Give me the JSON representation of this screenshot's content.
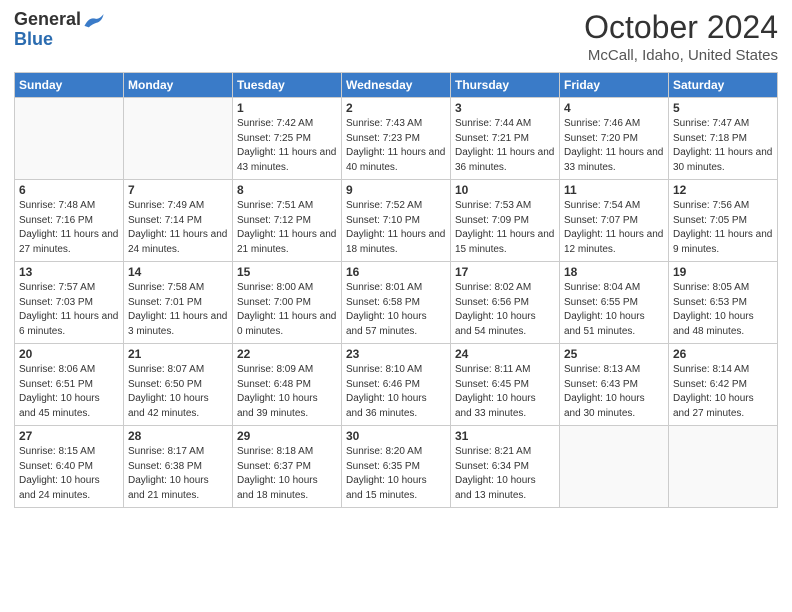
{
  "header": {
    "logo_general": "General",
    "logo_blue": "Blue",
    "month": "October 2024",
    "location": "McCall, Idaho, United States"
  },
  "days_of_week": [
    "Sunday",
    "Monday",
    "Tuesday",
    "Wednesday",
    "Thursday",
    "Friday",
    "Saturday"
  ],
  "weeks": [
    [
      {
        "day": "",
        "sunrise": "",
        "sunset": "",
        "daylight": ""
      },
      {
        "day": "",
        "sunrise": "",
        "sunset": "",
        "daylight": ""
      },
      {
        "day": "1",
        "sunrise": "Sunrise: 7:42 AM",
        "sunset": "Sunset: 7:25 PM",
        "daylight": "Daylight: 11 hours and 43 minutes."
      },
      {
        "day": "2",
        "sunrise": "Sunrise: 7:43 AM",
        "sunset": "Sunset: 7:23 PM",
        "daylight": "Daylight: 11 hours and 40 minutes."
      },
      {
        "day": "3",
        "sunrise": "Sunrise: 7:44 AM",
        "sunset": "Sunset: 7:21 PM",
        "daylight": "Daylight: 11 hours and 36 minutes."
      },
      {
        "day": "4",
        "sunrise": "Sunrise: 7:46 AM",
        "sunset": "Sunset: 7:20 PM",
        "daylight": "Daylight: 11 hours and 33 minutes."
      },
      {
        "day": "5",
        "sunrise": "Sunrise: 7:47 AM",
        "sunset": "Sunset: 7:18 PM",
        "daylight": "Daylight: 11 hours and 30 minutes."
      }
    ],
    [
      {
        "day": "6",
        "sunrise": "Sunrise: 7:48 AM",
        "sunset": "Sunset: 7:16 PM",
        "daylight": "Daylight: 11 hours and 27 minutes."
      },
      {
        "day": "7",
        "sunrise": "Sunrise: 7:49 AM",
        "sunset": "Sunset: 7:14 PM",
        "daylight": "Daylight: 11 hours and 24 minutes."
      },
      {
        "day": "8",
        "sunrise": "Sunrise: 7:51 AM",
        "sunset": "Sunset: 7:12 PM",
        "daylight": "Daylight: 11 hours and 21 minutes."
      },
      {
        "day": "9",
        "sunrise": "Sunrise: 7:52 AM",
        "sunset": "Sunset: 7:10 PM",
        "daylight": "Daylight: 11 hours and 18 minutes."
      },
      {
        "day": "10",
        "sunrise": "Sunrise: 7:53 AM",
        "sunset": "Sunset: 7:09 PM",
        "daylight": "Daylight: 11 hours and 15 minutes."
      },
      {
        "day": "11",
        "sunrise": "Sunrise: 7:54 AM",
        "sunset": "Sunset: 7:07 PM",
        "daylight": "Daylight: 11 hours and 12 minutes."
      },
      {
        "day": "12",
        "sunrise": "Sunrise: 7:56 AM",
        "sunset": "Sunset: 7:05 PM",
        "daylight": "Daylight: 11 hours and 9 minutes."
      }
    ],
    [
      {
        "day": "13",
        "sunrise": "Sunrise: 7:57 AM",
        "sunset": "Sunset: 7:03 PM",
        "daylight": "Daylight: 11 hours and 6 minutes."
      },
      {
        "day": "14",
        "sunrise": "Sunrise: 7:58 AM",
        "sunset": "Sunset: 7:01 PM",
        "daylight": "Daylight: 11 hours and 3 minutes."
      },
      {
        "day": "15",
        "sunrise": "Sunrise: 8:00 AM",
        "sunset": "Sunset: 7:00 PM",
        "daylight": "Daylight: 11 hours and 0 minutes."
      },
      {
        "day": "16",
        "sunrise": "Sunrise: 8:01 AM",
        "sunset": "Sunset: 6:58 PM",
        "daylight": "Daylight: 10 hours and 57 minutes."
      },
      {
        "day": "17",
        "sunrise": "Sunrise: 8:02 AM",
        "sunset": "Sunset: 6:56 PM",
        "daylight": "Daylight: 10 hours and 54 minutes."
      },
      {
        "day": "18",
        "sunrise": "Sunrise: 8:04 AM",
        "sunset": "Sunset: 6:55 PM",
        "daylight": "Daylight: 10 hours and 51 minutes."
      },
      {
        "day": "19",
        "sunrise": "Sunrise: 8:05 AM",
        "sunset": "Sunset: 6:53 PM",
        "daylight": "Daylight: 10 hours and 48 minutes."
      }
    ],
    [
      {
        "day": "20",
        "sunrise": "Sunrise: 8:06 AM",
        "sunset": "Sunset: 6:51 PM",
        "daylight": "Daylight: 10 hours and 45 minutes."
      },
      {
        "day": "21",
        "sunrise": "Sunrise: 8:07 AM",
        "sunset": "Sunset: 6:50 PM",
        "daylight": "Daylight: 10 hours and 42 minutes."
      },
      {
        "day": "22",
        "sunrise": "Sunrise: 8:09 AM",
        "sunset": "Sunset: 6:48 PM",
        "daylight": "Daylight: 10 hours and 39 minutes."
      },
      {
        "day": "23",
        "sunrise": "Sunrise: 8:10 AM",
        "sunset": "Sunset: 6:46 PM",
        "daylight": "Daylight: 10 hours and 36 minutes."
      },
      {
        "day": "24",
        "sunrise": "Sunrise: 8:11 AM",
        "sunset": "Sunset: 6:45 PM",
        "daylight": "Daylight: 10 hours and 33 minutes."
      },
      {
        "day": "25",
        "sunrise": "Sunrise: 8:13 AM",
        "sunset": "Sunset: 6:43 PM",
        "daylight": "Daylight: 10 hours and 30 minutes."
      },
      {
        "day": "26",
        "sunrise": "Sunrise: 8:14 AM",
        "sunset": "Sunset: 6:42 PM",
        "daylight": "Daylight: 10 hours and 27 minutes."
      }
    ],
    [
      {
        "day": "27",
        "sunrise": "Sunrise: 8:15 AM",
        "sunset": "Sunset: 6:40 PM",
        "daylight": "Daylight: 10 hours and 24 minutes."
      },
      {
        "day": "28",
        "sunrise": "Sunrise: 8:17 AM",
        "sunset": "Sunset: 6:38 PM",
        "daylight": "Daylight: 10 hours and 21 minutes."
      },
      {
        "day": "29",
        "sunrise": "Sunrise: 8:18 AM",
        "sunset": "Sunset: 6:37 PM",
        "daylight": "Daylight: 10 hours and 18 minutes."
      },
      {
        "day": "30",
        "sunrise": "Sunrise: 8:20 AM",
        "sunset": "Sunset: 6:35 PM",
        "daylight": "Daylight: 10 hours and 15 minutes."
      },
      {
        "day": "31",
        "sunrise": "Sunrise: 8:21 AM",
        "sunset": "Sunset: 6:34 PM",
        "daylight": "Daylight: 10 hours and 13 minutes."
      },
      {
        "day": "",
        "sunrise": "",
        "sunset": "",
        "daylight": ""
      },
      {
        "day": "",
        "sunrise": "",
        "sunset": "",
        "daylight": ""
      }
    ]
  ]
}
